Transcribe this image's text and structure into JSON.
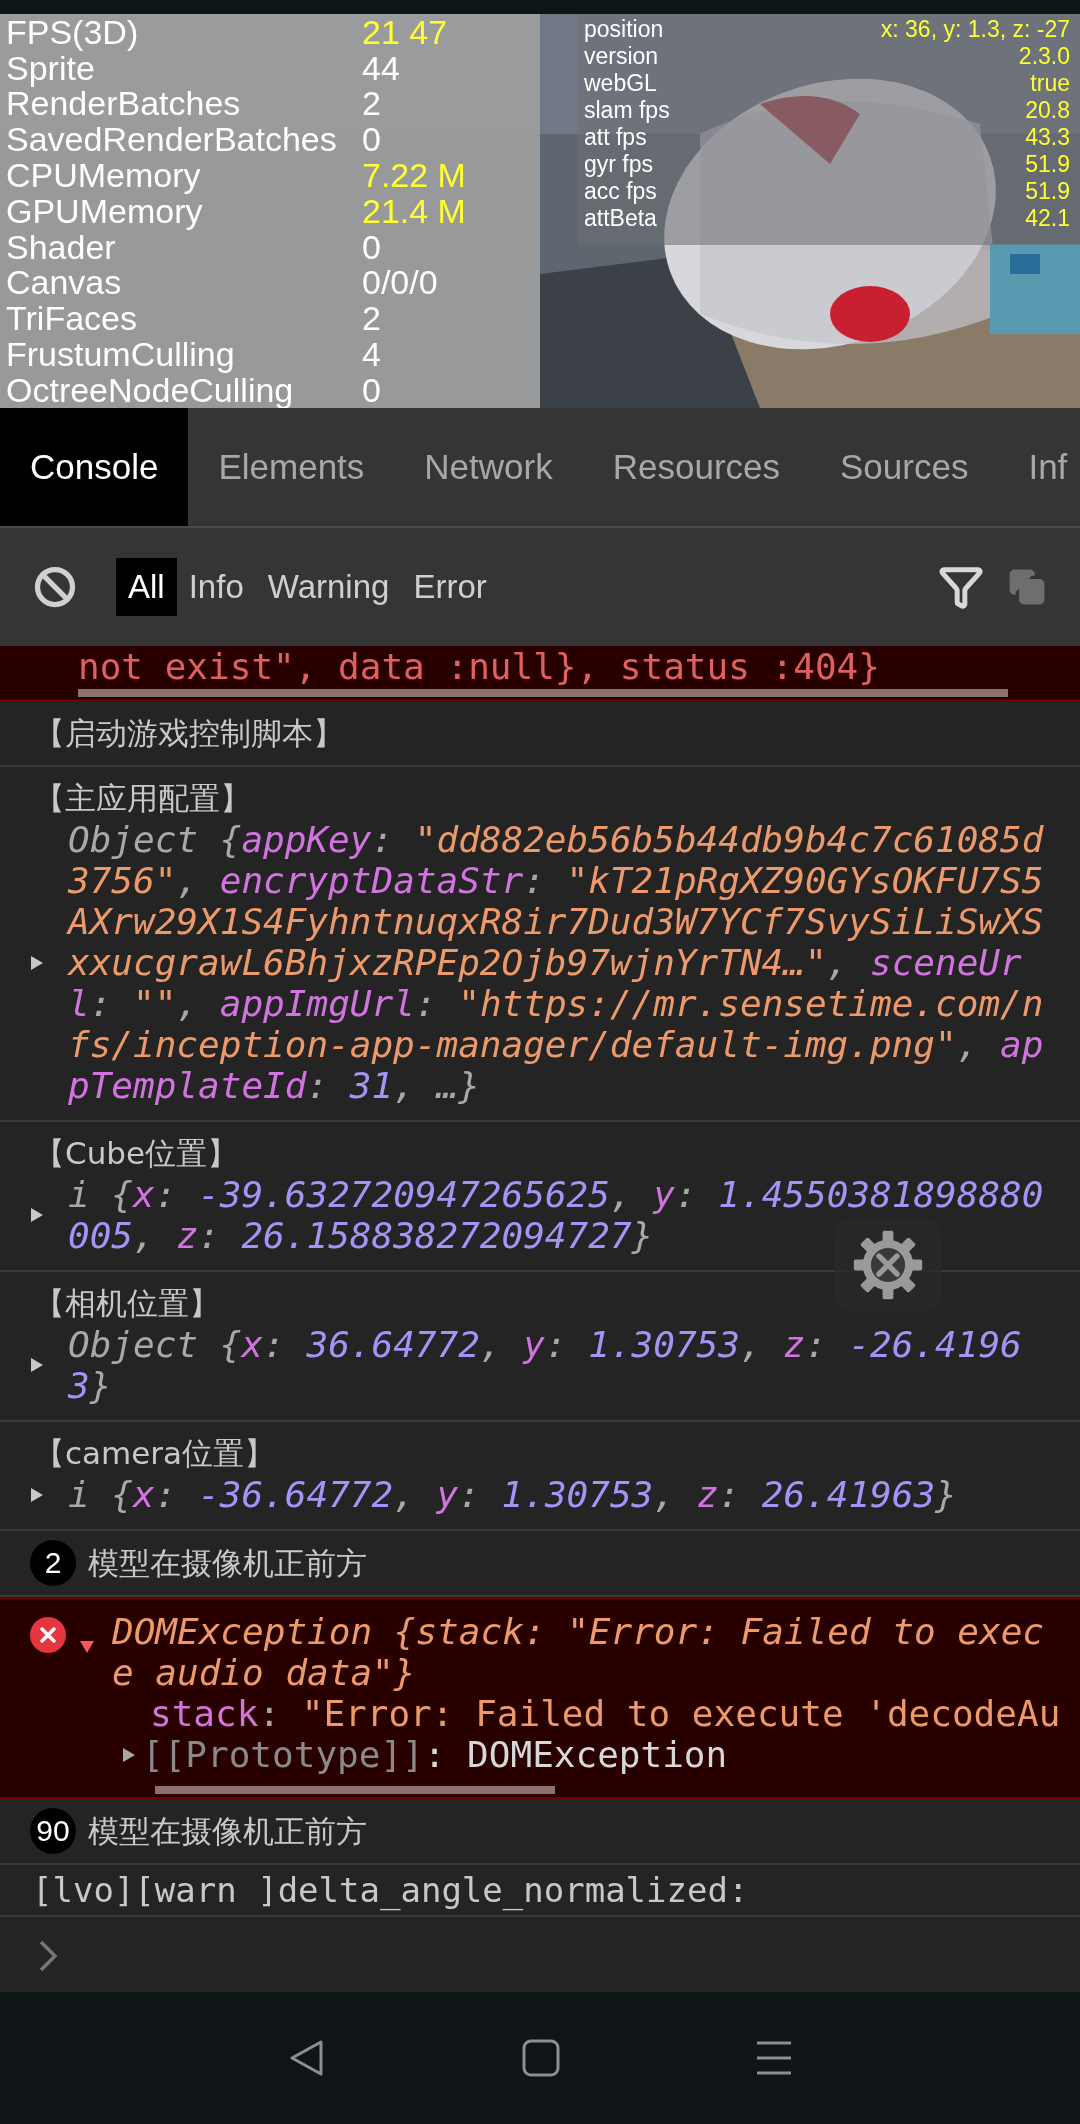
{
  "stats": [
    {
      "label": "FPS(3D)",
      "value": "21 47",
      "highlight": true
    },
    {
      "label": "Sprite",
      "value": "44",
      "highlight": false
    },
    {
      "label": "RenderBatches",
      "value": "2",
      "highlight": false
    },
    {
      "label": "SavedRenderBatches",
      "value": "0",
      "highlight": false
    },
    {
      "label": "CPUMemory",
      "value": "7.22 M",
      "highlight": true
    },
    {
      "label": "GPUMemory",
      "value": "21.4 M",
      "highlight": true
    },
    {
      "label": "Shader",
      "value": "0",
      "highlight": false
    },
    {
      "label": "Canvas",
      "value": "0/0/0",
      "highlight": false
    },
    {
      "label": "TriFaces",
      "value": "2",
      "highlight": false
    },
    {
      "label": "FrustumCulling",
      "value": "4",
      "highlight": false
    },
    {
      "label": "OctreeNodeCulling",
      "value": "0",
      "highlight": false
    }
  ],
  "engine_info": [
    {
      "label": "position",
      "value": "x: 36, y: 1.3, z: -27"
    },
    {
      "label": "version",
      "value": "2.3.0"
    },
    {
      "label": "webGL",
      "value": "true"
    },
    {
      "label": "slam fps",
      "value": "20.8"
    },
    {
      "label": "att fps",
      "value": "43.3"
    },
    {
      "label": "gyr fps",
      "value": "51.9"
    },
    {
      "label": "acc fps",
      "value": "51.9"
    },
    {
      "label": "attBeta",
      "value": "42.1"
    }
  ],
  "tabs": [
    {
      "label": "Console",
      "selected": true
    },
    {
      "label": "Elements",
      "selected": false
    },
    {
      "label": "Network",
      "selected": false
    },
    {
      "label": "Resources",
      "selected": false
    },
    {
      "label": "Sources",
      "selected": false
    },
    {
      "label": "Inf",
      "selected": false
    }
  ],
  "filters": [
    {
      "label": "All",
      "selected": true
    },
    {
      "label": "Info",
      "selected": false
    },
    {
      "label": "Warning",
      "selected": false
    },
    {
      "label": "Error",
      "selected": false
    }
  ],
  "copy_button": {
    "disabled": true
  },
  "logs": [
    {
      "kind": "cut_error",
      "text": "not exist\", data :null}, status :404}"
    },
    {
      "kind": "log",
      "text": "【启动游戏控制脚本】"
    },
    {
      "kind": "object",
      "label": "【主应用配置】",
      "expanded": false,
      "lines": [
        [
          {
            "kind": "type",
            "text": "Object "
          },
          {
            "kind": "punct",
            "text": "{"
          },
          {
            "kind": "key",
            "text": "appKey"
          },
          {
            "kind": "punct",
            "text": ": "
          },
          {
            "kind": "string",
            "text": "\"dd882eb56b5b44db9b4c7c61085d"
          }
        ],
        [
          {
            "kind": "string",
            "text": "3756\""
          },
          {
            "kind": "punct",
            "text": ", "
          },
          {
            "kind": "key",
            "text": "encryptDataStr"
          },
          {
            "kind": "punct",
            "text": ": "
          },
          {
            "kind": "string",
            "text": "\"kT21pRgXZ90GYsOKFU7S5"
          }
        ],
        [
          {
            "kind": "string",
            "text": "AXrw29X1S4FyhntnuqxR8ir7Dud3W7YCf7SvySiLiSwXS"
          }
        ],
        [
          {
            "kind": "string",
            "text": "xxucgrawL6BhjxzRPEp2Ojb97wjnYrTN4…\""
          },
          {
            "kind": "punct",
            "text": ", "
          },
          {
            "kind": "key",
            "text": "sceneUr"
          }
        ],
        [
          {
            "kind": "key",
            "text": "l"
          },
          {
            "kind": "punct",
            "text": ": "
          },
          {
            "kind": "string",
            "text": "\"\""
          },
          {
            "kind": "punct",
            "text": ", "
          },
          {
            "kind": "key",
            "text": "appImgUrl"
          },
          {
            "kind": "punct",
            "text": ": "
          },
          {
            "kind": "string",
            "text": "\"https://mr.sensetime.com/n"
          }
        ],
        [
          {
            "kind": "string",
            "text": "fs/inception-app-manager/default-img.png\""
          },
          {
            "kind": "punct",
            "text": ", "
          },
          {
            "kind": "key",
            "text": "ap"
          }
        ],
        [
          {
            "kind": "key",
            "text": "pTemplateId"
          },
          {
            "kind": "punct",
            "text": ": "
          },
          {
            "kind": "number",
            "text": "31"
          },
          {
            "kind": "punct",
            "text": ", …}"
          }
        ]
      ]
    },
    {
      "kind": "object",
      "label": "【Cube位置】",
      "expanded": false,
      "lines": [
        [
          {
            "kind": "type",
            "text": "i "
          },
          {
            "kind": "punct",
            "text": "{"
          },
          {
            "kind": "key",
            "text": "x"
          },
          {
            "kind": "punct",
            "text": ": "
          },
          {
            "kind": "number",
            "text": "-39.632720947265625"
          },
          {
            "kind": "punct",
            "text": ", "
          },
          {
            "kind": "key",
            "text": "y"
          },
          {
            "kind": "punct",
            "text": ": "
          },
          {
            "kind": "number",
            "text": "1.4550381898880"
          }
        ],
        [
          {
            "kind": "number",
            "text": "005"
          },
          {
            "kind": "punct",
            "text": ", "
          },
          {
            "kind": "key",
            "text": "z"
          },
          {
            "kind": "punct",
            "text": ": "
          },
          {
            "kind": "number",
            "text": "26.158838272094727"
          },
          {
            "kind": "punct",
            "text": "}"
          }
        ]
      ]
    },
    {
      "kind": "object",
      "label": "【相机位置】",
      "expanded": false,
      "lines": [
        [
          {
            "kind": "type",
            "text": "Object "
          },
          {
            "kind": "punct",
            "text": "{"
          },
          {
            "kind": "key",
            "text": "x"
          },
          {
            "kind": "punct",
            "text": ": "
          },
          {
            "kind": "number",
            "text": "36.64772"
          },
          {
            "kind": "punct",
            "text": ", "
          },
          {
            "kind": "key",
            "text": "y"
          },
          {
            "kind": "punct",
            "text": ": "
          },
          {
            "kind": "number",
            "text": "1.30753"
          },
          {
            "kind": "punct",
            "text": ", "
          },
          {
            "kind": "key",
            "text": "z"
          },
          {
            "kind": "punct",
            "text": ": "
          },
          {
            "kind": "number",
            "text": "-26.4196"
          }
        ],
        [
          {
            "kind": "number",
            "text": "3"
          },
          {
            "kind": "punct",
            "text": "}"
          }
        ]
      ]
    },
    {
      "kind": "object",
      "label": "【camera位置】",
      "expanded": false,
      "lines": [
        [
          {
            "kind": "type",
            "text": "i "
          },
          {
            "kind": "punct",
            "text": "{"
          },
          {
            "kind": "key",
            "text": "x"
          },
          {
            "kind": "punct",
            "text": ": "
          },
          {
            "kind": "number",
            "text": "-36.64772"
          },
          {
            "kind": "punct",
            "text": ", "
          },
          {
            "kind": "key",
            "text": "y"
          },
          {
            "kind": "punct",
            "text": ": "
          },
          {
            "kind": "number",
            "text": "1.30753"
          },
          {
            "kind": "punct",
            "text": ", "
          },
          {
            "kind": "key",
            "text": "z"
          },
          {
            "kind": "punct",
            "text": ": "
          },
          {
            "kind": "number",
            "text": "26.41963"
          },
          {
            "kind": "punct",
            "text": "}"
          }
        ]
      ]
    },
    {
      "kind": "repeat",
      "count": "2",
      "text": "模型在摄像机正前方"
    },
    {
      "kind": "error",
      "expanded": true,
      "lines": [
        [
          {
            "kind": "error",
            "text": "DOMException {stack: \"Error: Failed to exec"
          }
        ],
        [
          {
            "kind": "error",
            "text": "e audio data\"}"
          }
        ]
      ],
      "children": [
        {
          "lines": [
            [
              {
                "kind": "key",
                "text": "stack"
              },
              {
                "kind": "punct",
                "text": ": "
              },
              {
                "kind": "string",
                "text": "\"Error: Failed to execute 'decodeAu"
              }
            ]
          ]
        },
        {
          "expanded": false,
          "lines": [
            [
              {
                "kind": "dim",
                "text": "[[Prototype]]"
              },
              {
                "kind": "plain",
                "text": ": DOMException"
              }
            ]
          ]
        }
      ]
    },
    {
      "kind": "repeat",
      "count": "90",
      "text": "模型在摄像机正前方"
    },
    {
      "kind": "mono",
      "text": "[lvo][warn ]delta_angle_normalized:"
    }
  ]
}
